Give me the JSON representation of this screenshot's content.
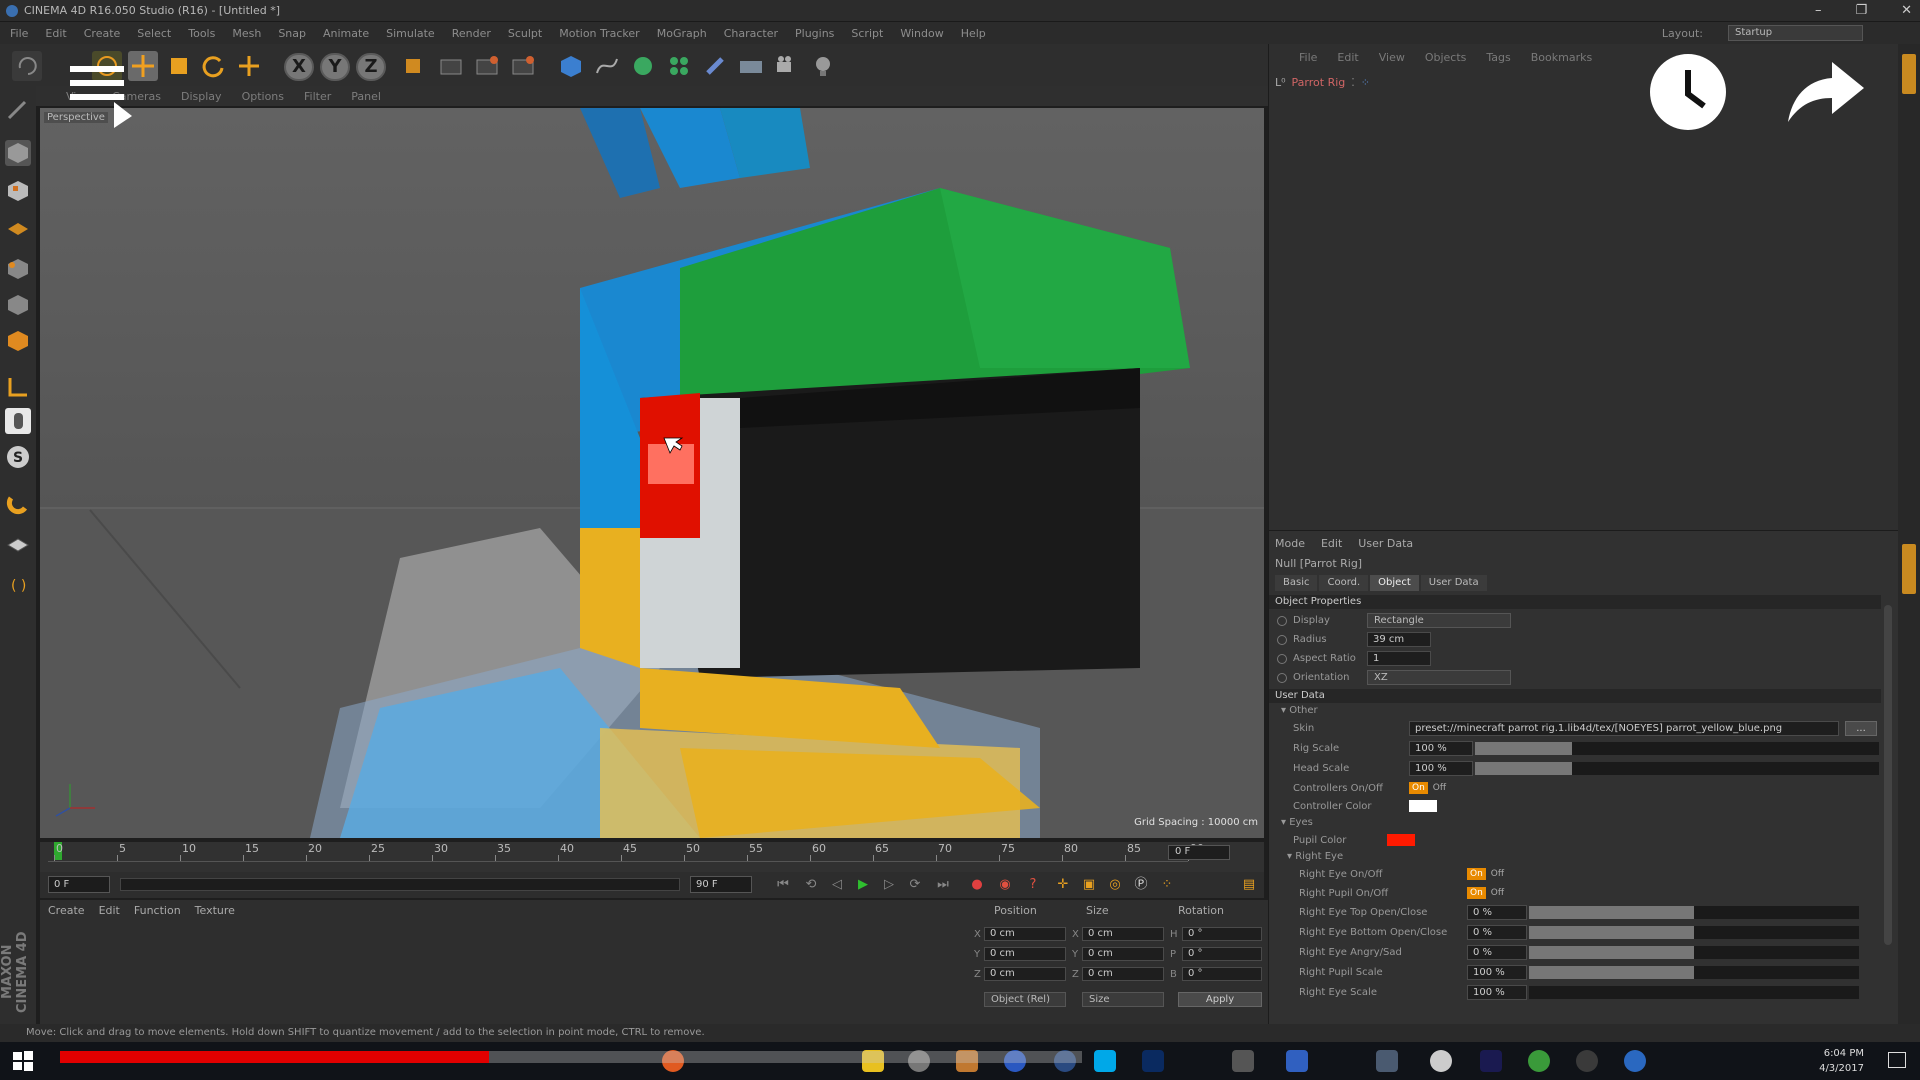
{
  "window": {
    "title": "CINEMA 4D R16.050 Studio (R16) - [Untitled *]",
    "min": "–",
    "max": "❐",
    "close": "✕"
  },
  "menu": [
    "File",
    "Edit",
    "Create",
    "Select",
    "Tools",
    "Mesh",
    "Snap",
    "Animate",
    "Simulate",
    "Render",
    "Sculpt",
    "Motion Tracker",
    "MoGraph",
    "Character",
    "Plugins",
    "Script",
    "Window",
    "Help"
  ],
  "layout": {
    "label": "Layout:",
    "value": "Startup"
  },
  "viewport": {
    "menu": [
      "View",
      "Cameras",
      "Display",
      "Options",
      "Filter",
      "Panel"
    ],
    "label": "Perspective",
    "grid_spacing": "Grid Spacing : 10000 cm"
  },
  "timeline": {
    "ticks": [
      "0",
      "5",
      "10",
      "15",
      "20",
      "25",
      "30",
      "35",
      "40",
      "45",
      "50",
      "55",
      "60",
      "65",
      "70",
      "75",
      "80",
      "85",
      "90"
    ],
    "current_frame": "0 F",
    "start": "0 F",
    "end": "90 F"
  },
  "materials": {
    "menu": [
      "Create",
      "Edit",
      "Function",
      "Texture"
    ]
  },
  "coords": {
    "headers": {
      "position": "Position",
      "size": "Size",
      "rotation": "Rotation"
    },
    "rows": [
      {
        "axis": "X",
        "pos": "0 cm",
        "saxis": "X",
        "size": "0 cm",
        "raxis": "H",
        "rot": "0 °"
      },
      {
        "axis": "Y",
        "pos": "0 cm",
        "saxis": "Y",
        "size": "0 cm",
        "raxis": "P",
        "rot": "0 °"
      },
      {
        "axis": "Z",
        "pos": "0 cm",
        "saxis": "Z",
        "size": "0 cm",
        "raxis": "B",
        "rot": "0 °"
      }
    ],
    "mode": "Object (Rel)",
    "size_mode": "Size",
    "apply": "Apply"
  },
  "brand": "MAXON CINEMA 4D",
  "status": "Move: Click and drag to move elements. Hold down SHIFT to quantize movement / add to the selection in point mode, CTRL to remove.",
  "objects": {
    "menu": [
      "File",
      "Edit",
      "View",
      "Objects",
      "Tags",
      "Bookmarks"
    ],
    "item": "Parrot Rig"
  },
  "attributes": {
    "menu": [
      "Mode",
      "Edit",
      "User Data"
    ],
    "object_name": "Null [Parrot Rig]",
    "tabs": [
      "Basic",
      "Coord.",
      "Object",
      "User Data"
    ],
    "sections": {
      "object": "Object Properties",
      "userdata": "User Data"
    },
    "groups": {
      "other": "Other",
      "eyes": "Eyes",
      "right_eye": "Right Eye"
    },
    "display": {
      "label": "Display",
      "value": "Rectangle"
    },
    "radius": {
      "label": "Radius",
      "value": "39 cm"
    },
    "aspect": {
      "label": "Aspect Ratio",
      "value": "1"
    },
    "orientation": {
      "label": "Orientation",
      "value": "XZ"
    },
    "skin": {
      "label": "Skin",
      "value": "preset://minecraft parrot rig.1.lib4d/tex/[NOEYES] parrot_yellow_blue.png",
      "btn": "..."
    },
    "rig_scale": {
      "label": "Rig Scale",
      "value": "100 %",
      "fill": 0.24
    },
    "head_scale": {
      "label": "Head Scale",
      "value": "100 %",
      "fill": 0.24
    },
    "controllers": {
      "label": "Controllers On/Off",
      "on": "On",
      "off": "Off"
    },
    "controller_color": {
      "label": "Controller Color",
      "color": "#ffffff"
    },
    "pupil_color": {
      "label": "Pupil Color",
      "color": "#ff1a00"
    },
    "right_eye_onoff": {
      "label": "Right Eye On/Off",
      "on": "On",
      "off": "Off"
    },
    "right_pupil_onoff": {
      "label": "Right Pupil On/Off",
      "on": "On",
      "off": "Off"
    },
    "right_eye_top": {
      "label": "Right Eye Top Open/Close",
      "value": "0 %",
      "fill": 0.5
    },
    "right_eye_bottom": {
      "label": "Right Eye Bottom Open/Close",
      "value": "0 %",
      "fill": 0.5
    },
    "right_eye_angry": {
      "label": "Right Eye Angry/Sad",
      "value": "0 %",
      "fill": 0.5
    },
    "right_pupil_scale": {
      "label": "Right Pupil Scale",
      "value": "100 %",
      "fill": 0.5
    },
    "right_eye_scale": {
      "label": "Right Eye Scale",
      "value": "100 %",
      "fill": 0.0
    }
  },
  "taskbar": {
    "time": "6:04 PM",
    "date": "4/3/2017"
  },
  "video": {
    "progress": 0.42
  }
}
